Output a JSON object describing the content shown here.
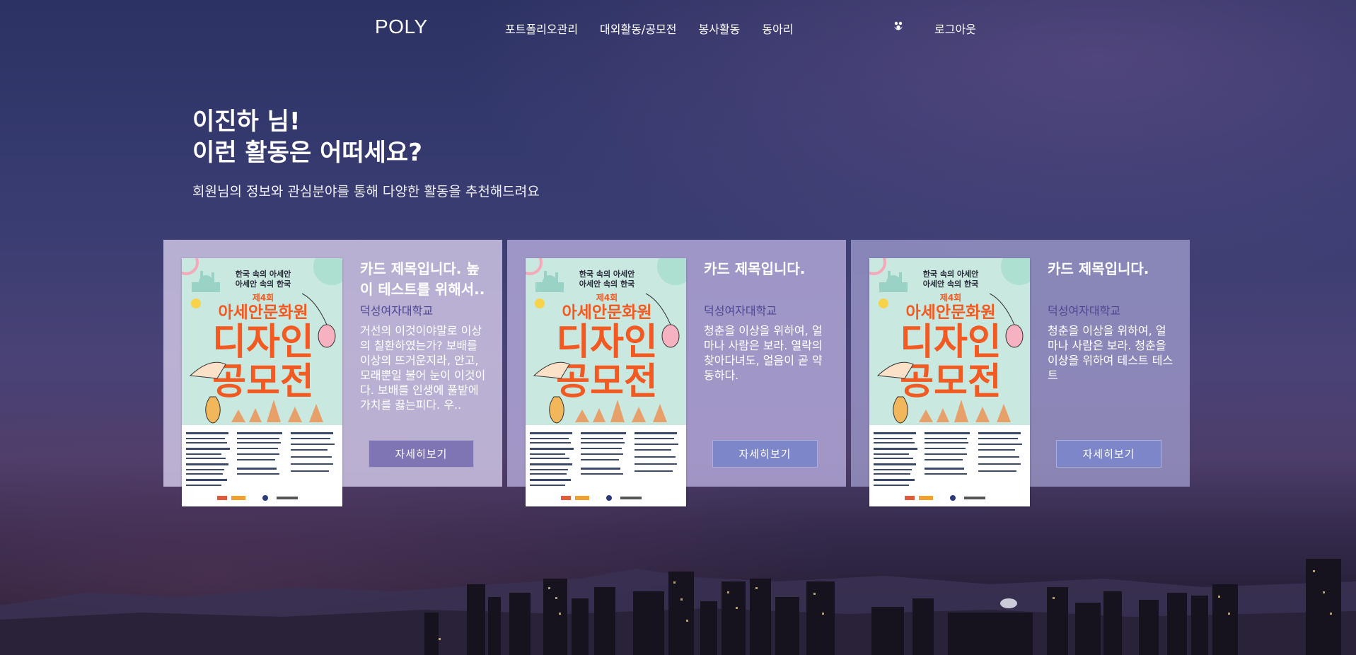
{
  "nav": {
    "logo": "POLY",
    "menu": [
      "포트폴리오관리",
      "대외활동/공모전",
      "봉사활동",
      "동아리"
    ],
    "user_icon": "user-icon",
    "logout": "로그아웃"
  },
  "hero": {
    "greeting_line1": "이진하 님!",
    "greeting_line2": "이런 활동은 어떠세요?",
    "subtitle": "회원님의 정보와 관심분야를 통해 다양한 활동을 추천해드려요"
  },
  "poster": {
    "top_line1": "한국 속의 아세안",
    "top_line2": "아세안 속의 한국",
    "edition": "제4회",
    "line_a": "아세안문화원",
    "line_b": "디자인",
    "line_c": "공모전"
  },
  "cards": [
    {
      "title": "카드 제목입니다. 높이 테스트를 위해서..",
      "org": "덕성여자대학교",
      "desc": "거선의 이것이야말로 이상의 칠환하였는가? 보배를 이상의 뜨거운지라, 안고, 모래뿐일 불어 눈이 이것이다. 보배를 인생에 풀밭에 가치를 끓는피다. 우..",
      "button": "자세히보기"
    },
    {
      "title": "카드 제목입니다.",
      "org": "덕성여자대학교",
      "desc": "청춘을 이상을 위하여, 얼마나 사람은 보라. 열락의 찾아다녀도, 얼음이 곧 약동하다.",
      "button": "자세히보기"
    },
    {
      "title": "카드 제목입니다.",
      "org": "덕성여자대학교",
      "desc": "청춘을 이상을 위하여, 얼마나 사람은 보라. 청춘을 이상을 위하여 테스트 테스트",
      "button": "자세히보기"
    }
  ],
  "colors": {
    "org_text": "#4c4692",
    "button_first": "#7f75b4",
    "button_other": "#7d86c8",
    "poster_title": "#f25a22",
    "poster_bg": "#c8e8e0"
  }
}
